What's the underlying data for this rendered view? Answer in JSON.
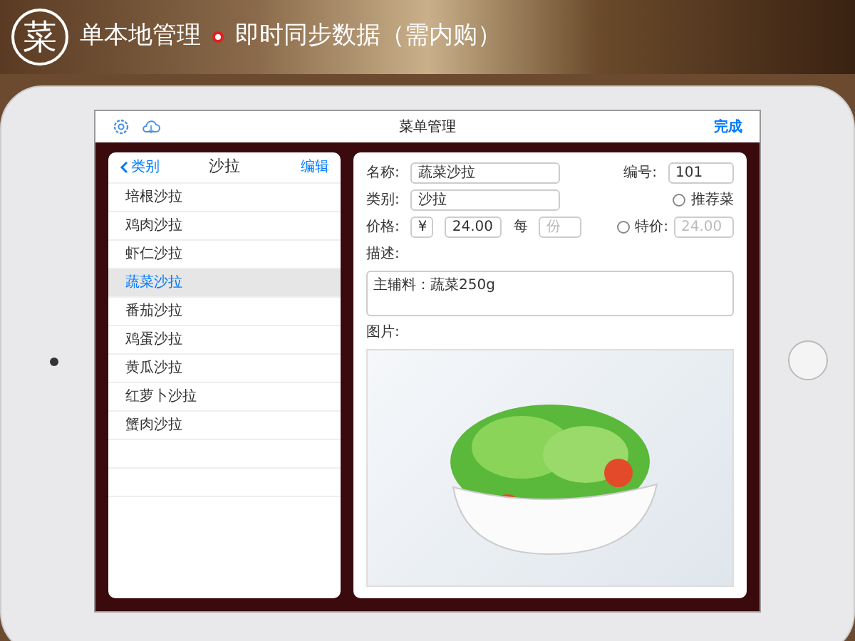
{
  "banner": {
    "logo": "菜",
    "left_text": "单本地管理",
    "right_text": "即时同步数据（需内购）"
  },
  "navbar": {
    "title": "菜单管理",
    "done": "完成"
  },
  "list": {
    "back": "类别",
    "title": "沙拉",
    "edit": "编辑",
    "items": [
      {
        "label": "培根沙拉",
        "selected": false
      },
      {
        "label": "鸡肉沙拉",
        "selected": false
      },
      {
        "label": "虾仁沙拉",
        "selected": false
      },
      {
        "label": "蔬菜沙拉",
        "selected": true
      },
      {
        "label": "番茄沙拉",
        "selected": false
      },
      {
        "label": "鸡蛋沙拉",
        "selected": false
      },
      {
        "label": "黄瓜沙拉",
        "selected": false
      },
      {
        "label": "红萝卜沙拉",
        "selected": false
      },
      {
        "label": "蟹肉沙拉",
        "selected": false
      }
    ]
  },
  "form": {
    "name_label": "名称:",
    "name_value": "蔬菜沙拉",
    "number_label": "编号:",
    "number_value": "101",
    "category_label": "类别:",
    "category_value": "沙拉",
    "recommend": {
      "label": "推荐菜",
      "checked": false
    },
    "price_label": "价格:",
    "currency": "¥",
    "price_value": "24.00",
    "per_label": "每",
    "unit_placeholder": "份",
    "special": {
      "label": "特价:",
      "checked": false,
      "placeholder": "24.00"
    },
    "description_label": "描述:",
    "description_value": "主辅料：蔬菜250g",
    "image_label": "图片:"
  }
}
